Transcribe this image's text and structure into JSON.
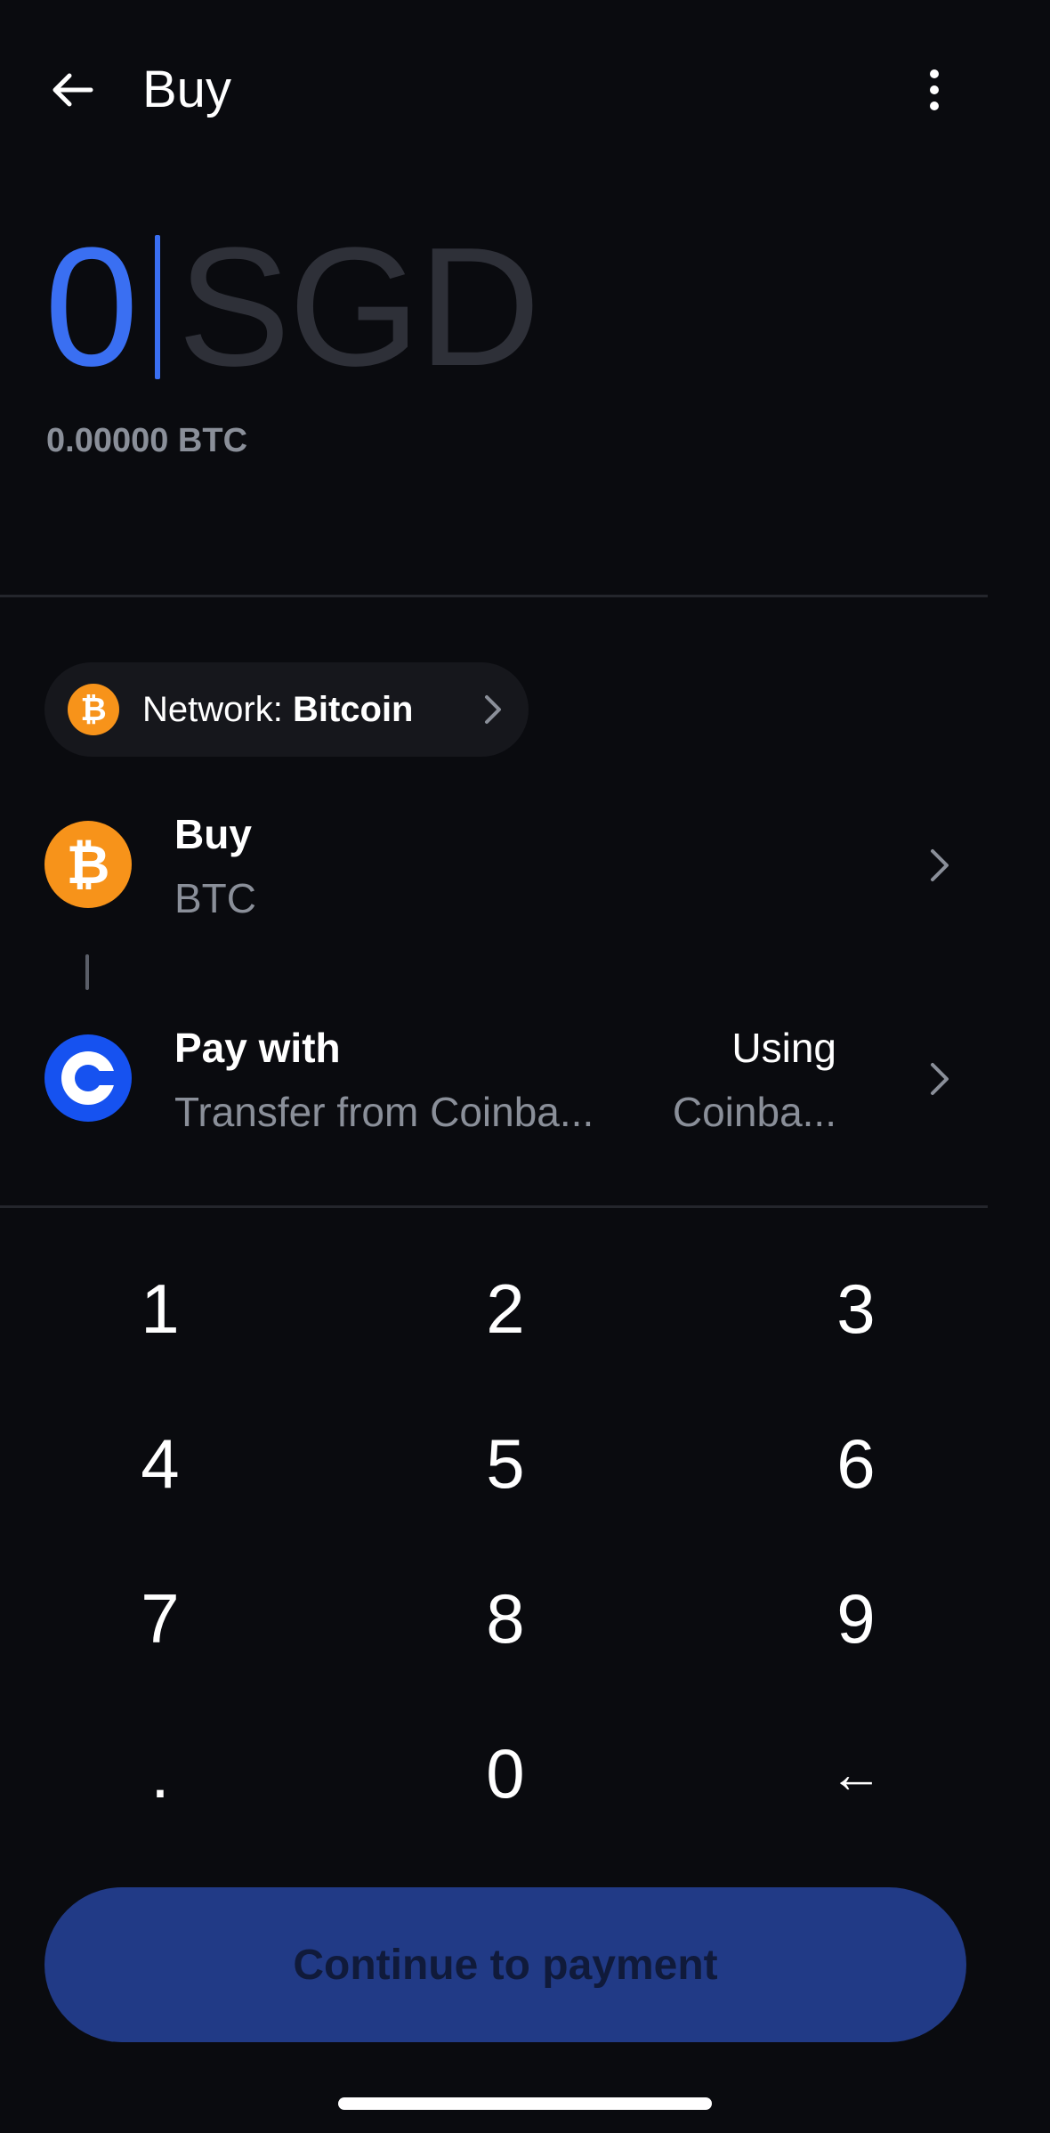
{
  "header": {
    "title": "Buy",
    "back_icon": "arrow-left-icon",
    "more_icon": "more-vertical-icon"
  },
  "amount": {
    "value": "0",
    "currency": "SGD",
    "converted": "0.00000 BTC"
  },
  "network": {
    "label": "Network: ",
    "value": "Bitcoin",
    "icon": "bitcoin-icon"
  },
  "buy_row": {
    "label": "Buy",
    "asset": "BTC",
    "icon": "bitcoin-icon"
  },
  "pay_row": {
    "label": "Pay with",
    "method": "Transfer from Coinba...",
    "using_label": "Using",
    "using_value": "Coinba...",
    "icon": "coinbase-icon"
  },
  "keypad": {
    "keys": [
      "1",
      "2",
      "3",
      "4",
      "5",
      "6",
      "7",
      "8",
      "9",
      ".",
      "0",
      "←"
    ]
  },
  "continue_button": {
    "label": "Continue to payment"
  },
  "colors": {
    "background": "#0a0b0f",
    "accent": "#3a6ff2",
    "bitcoin": "#f7931a",
    "coinbase": "#1652f0",
    "button_disabled": "#213a86"
  }
}
